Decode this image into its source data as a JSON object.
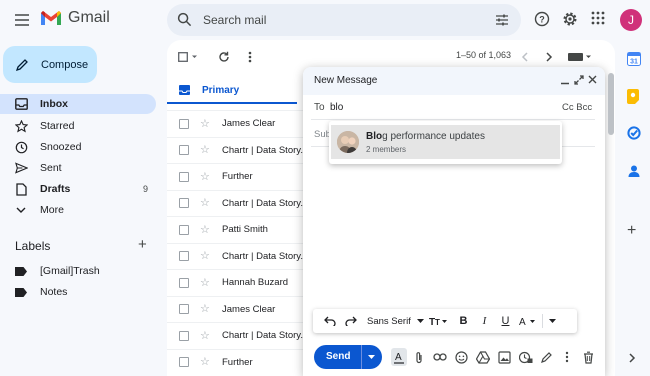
{
  "app": {
    "name": "Gmail",
    "avatar_letter": "J",
    "accent": "#0b57d0",
    "avatar_color": "#d0317a"
  },
  "search": {
    "placeholder": "Search mail"
  },
  "nav": {
    "compose": "Compose",
    "items": [
      {
        "label": "Inbox",
        "icon": "inbox-icon",
        "active": true
      },
      {
        "label": "Starred",
        "icon": "star-icon"
      },
      {
        "label": "Snoozed",
        "icon": "clock-icon"
      },
      {
        "label": "Sent",
        "icon": "send-icon"
      },
      {
        "label": "Drafts",
        "icon": "draft-icon",
        "count": "9"
      },
      {
        "label": "More",
        "icon": "chevron-down-icon"
      }
    ],
    "labels_heading": "Labels",
    "labels": [
      {
        "label": "[Gmail]Trash"
      },
      {
        "label": "Notes"
      }
    ]
  },
  "mail": {
    "pager": "1–50 of 1,063",
    "tab": "Primary",
    "rows": [
      {
        "sender": "James Clear"
      },
      {
        "sender": "Chartr | Data Story."
      },
      {
        "sender": "Further"
      },
      {
        "sender": "Chartr | Data Story."
      },
      {
        "sender": "Patti Smith"
      },
      {
        "sender": "Chartr | Data Story."
      },
      {
        "sender": "Hannah Buzard"
      },
      {
        "sender": "James Clear"
      },
      {
        "sender": "Chartr | Data Story."
      },
      {
        "sender": "Further"
      }
    ]
  },
  "compose": {
    "title": "New Message",
    "to_label": "To",
    "to_value": "blo",
    "cc_bcc": "Cc Bcc",
    "subject_placeholder": "Subj",
    "suggestion": {
      "match": "Blo",
      "rest": "g performance updates",
      "sub": "2 members"
    },
    "font": "Sans Serif",
    "send": "Send"
  }
}
